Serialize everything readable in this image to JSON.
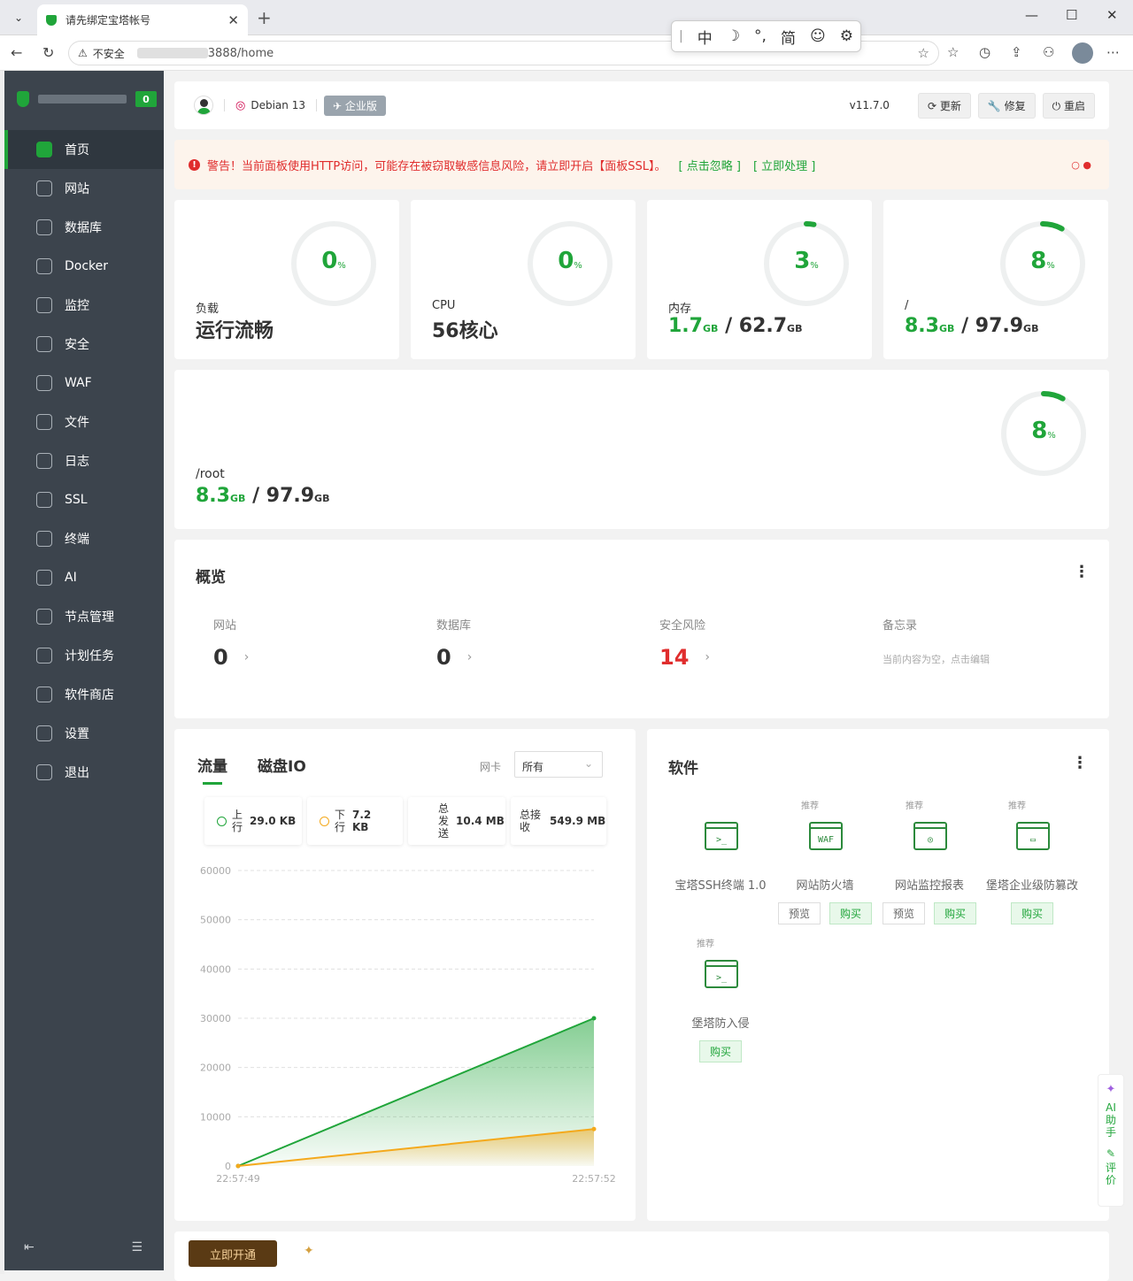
{
  "browser": {
    "tab_title": "请先绑定宝塔帐号",
    "insecure": "不安全",
    "url": "3888/home",
    "ime": [
      "中",
      "☽",
      "°,",
      "简",
      "☺",
      "⚙"
    ]
  },
  "sidebar": {
    "badge": "0",
    "items": [
      {
        "label": "首页",
        "icon": "home-icon"
      },
      {
        "label": "网站",
        "icon": "globe-icon"
      },
      {
        "label": "数据库",
        "icon": "database-icon"
      },
      {
        "label": "Docker",
        "icon": "docker-icon"
      },
      {
        "label": "监控",
        "icon": "monitor-icon"
      },
      {
        "label": "安全",
        "icon": "shield-icon"
      },
      {
        "label": "WAF",
        "icon": "waf-icon"
      },
      {
        "label": "文件",
        "icon": "folder-icon"
      },
      {
        "label": "日志",
        "icon": "log-icon"
      },
      {
        "label": "SSL",
        "icon": "ssl-icon"
      },
      {
        "label": "终端",
        "icon": "terminal-icon"
      },
      {
        "label": "AI",
        "icon": "ai-icon"
      },
      {
        "label": "节点管理",
        "icon": "node-icon"
      },
      {
        "label": "计划任务",
        "icon": "calendar-icon"
      },
      {
        "label": "软件商店",
        "icon": "store-icon"
      },
      {
        "label": "设置",
        "icon": "gear-icon"
      },
      {
        "label": "退出",
        "icon": "logout-icon"
      }
    ]
  },
  "topbar": {
    "os": "Debian 13",
    "edition": "企业版",
    "version": "v11.7.0",
    "update": "更新",
    "repair": "修复",
    "restart": "重启"
  },
  "alert": {
    "text": "警告！当前面板使用HTTP访问，可能存在被窃取敏感信息风险，请立即开启【面板SSL】。",
    "ignore": "[ 点击忽略 ]",
    "fix": "[ 立即处理 ]"
  },
  "stats": [
    {
      "label": "负载",
      "value": "运行流畅",
      "pct": 0
    },
    {
      "label": "CPU",
      "value": "56核心",
      "pct": 0
    },
    {
      "label": "内存",
      "used": "1.7",
      "total": "62.7",
      "unit": "GB",
      "pct": 3
    },
    {
      "label": "/",
      "used": "8.3",
      "total": "97.9",
      "unit": "GB",
      "pct": 8
    }
  ],
  "disk_root": {
    "label": "/root",
    "used": "8.3",
    "total": "97.9",
    "unit": "GB",
    "pct": 8
  },
  "overview": {
    "title": "概览",
    "items": [
      {
        "label": "网站",
        "value": "0"
      },
      {
        "label": "数据库",
        "value": "0"
      },
      {
        "label": "安全风险",
        "value": "14"
      }
    ],
    "memo_label": "备忘录",
    "memo_text": "当前内容为空，点击编辑"
  },
  "traffic": {
    "tab1": "流量",
    "tab2": "磁盘IO",
    "nic_label": "网卡",
    "nic_value": "所有",
    "up_label": "上行",
    "up_value": "29.0 KB",
    "down_label": "下行",
    "down_value": "7.2 KB",
    "sent_label": "总发送",
    "sent_value": "10.4 MB",
    "recv_label": "总接收",
    "recv_value": "549.9 MB"
  },
  "chart_data": {
    "type": "area",
    "x": [
      "22:57:49",
      "22:57:52"
    ],
    "series": [
      {
        "name": "上行",
        "values": [
          0,
          29.0
        ],
        "color": "#20a53a"
      },
      {
        "name": "下行",
        "values": [
          0,
          7.2
        ],
        "color": "#f4a91c"
      }
    ],
    "yticks": [
      0,
      10000,
      20000,
      30000,
      40000,
      50000,
      60000
    ],
    "ylim": [
      0,
      60000
    ],
    "y_plot_values": [
      [
        0,
        30000
      ],
      [
        0,
        7500
      ]
    ],
    "grid": true
  },
  "software": {
    "title": "软件",
    "rec": "推荐",
    "preview": "预览",
    "buy": "购买",
    "items": [
      {
        "name": "宝塔SSH终端 1.0"
      },
      {
        "name": "网站防火墙"
      },
      {
        "name": "网站监控报表"
      },
      {
        "name": "堡塔企业级防篡改"
      },
      {
        "name": "堡塔防入侵"
      }
    ]
  },
  "bottom": {
    "open": "立即开通"
  },
  "ai_float": {
    "label": "AI助手",
    "rate": "评价"
  }
}
